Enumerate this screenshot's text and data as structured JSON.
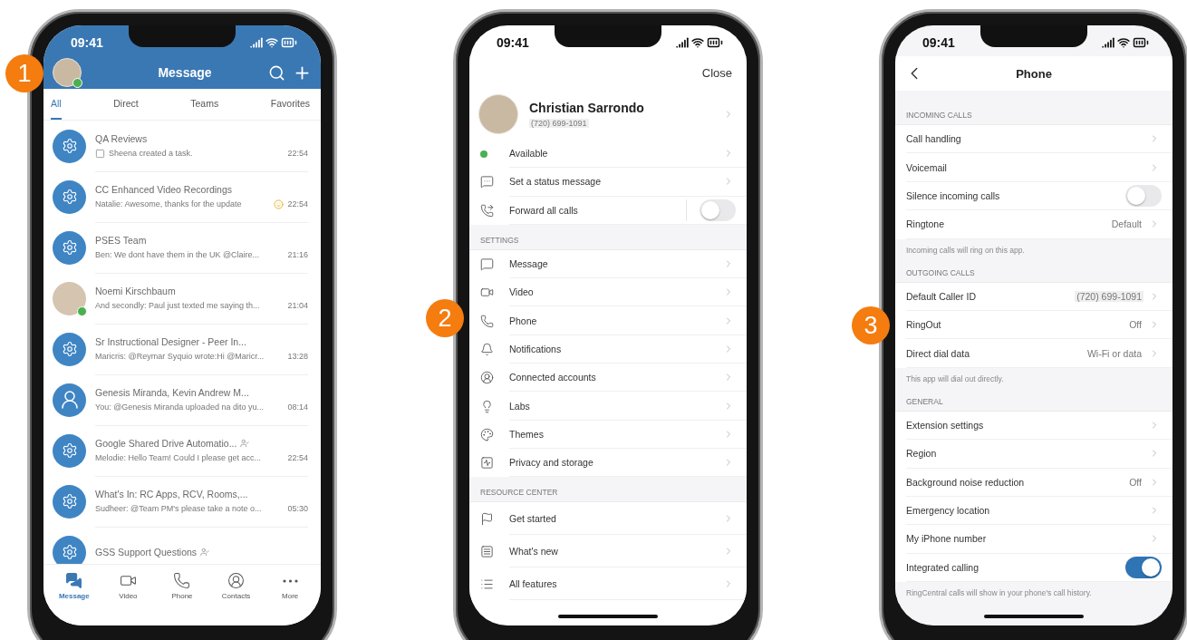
{
  "phones": [
    {
      "kind": "messages",
      "badge": "1",
      "time": "09:41",
      "header": {
        "title": "Message",
        "online": true
      },
      "tabs": [
        {
          "label": "All",
          "selected": true
        },
        {
          "label": "Direct",
          "selected": false
        },
        {
          "label": "Teams",
          "selected": false
        },
        {
          "label": "Favorites",
          "selected": false
        }
      ],
      "list": {
        "items": [
          {
            "kind": "team",
            "title": "QA Reviews",
            "preview": "Sheena created a task.",
            "time": "22:54",
            "task": true,
            "emoji": false,
            "guest": false,
            "online": false
          },
          {
            "kind": "team",
            "title": "CC Enhanced Video Recordings",
            "preview": "Natalie: Awesome, thanks for the update",
            "time": "22:54",
            "task": false,
            "emoji": true,
            "guest": false,
            "online": false
          },
          {
            "kind": "team",
            "title": "PSES Team",
            "preview": "Ben: We dont have them in the UK @Claire...",
            "time": "21:16",
            "task": false,
            "emoji": false,
            "guest": false,
            "online": false
          },
          {
            "kind": "person",
            "title": "Noemi Kirschbaum",
            "preview": "And secondly: Paul just texted me saying th...",
            "time": "21:04",
            "task": false,
            "emoji": false,
            "guest": false,
            "online": true
          },
          {
            "kind": "team",
            "title": "Sr Instructional Designer - Peer In...",
            "preview": "Maricris: @Reymar Syquio wrote:Hi @Maricr...",
            "time": "13:28",
            "task": false,
            "emoji": false,
            "guest": false,
            "online": false
          },
          {
            "kind": "group",
            "title": "Genesis Miranda, Kevin Andrew M...",
            "preview": "You: @Genesis Miranda uploaded na dito yu...",
            "time": "08:14",
            "task": false,
            "emoji": false,
            "guest": false,
            "online": false
          },
          {
            "kind": "team",
            "title": "Google Shared Drive Automatio...",
            "preview": "Melodie: Hello Team! Could I please get acc...",
            "time": "22:54",
            "task": false,
            "emoji": false,
            "guest": true,
            "online": false
          },
          {
            "kind": "team",
            "title": "What's In: RC Apps, RCV, Rooms,...",
            "preview": "Sudheer: @Team PM's please take a note o...",
            "time": "05:30",
            "task": false,
            "emoji": false,
            "guest": false,
            "online": false
          },
          {
            "kind": "team",
            "title": "GSS Support Questions",
            "task": false,
            "emoji": false,
            "guest": true,
            "online": false
          }
        ]
      },
      "nav": [
        {
          "label": "Message",
          "selected": true
        },
        {
          "label": "Video",
          "selected": false
        },
        {
          "label": "Phone",
          "selected": false
        },
        {
          "label": "Contacts",
          "selected": false
        },
        {
          "label": "More",
          "selected": false
        }
      ]
    },
    {
      "kind": "profile",
      "badge": "2",
      "time": "09:41",
      "close": "Close",
      "profile": {
        "name": "Christian Sarrondo",
        "phone": "(720) 699-1091",
        "blurred": true
      },
      "groups": [
        {
          "rows": [
            {
              "kind": "status",
              "label": "Available",
              "color": "#4caf50"
            },
            {
              "kind": "link",
              "label": "Set a status message"
            },
            {
              "kind": "toggle",
              "label": "Forward all calls",
              "on": false
            }
          ]
        },
        {
          "header": "SETTINGS",
          "rows": [
            {
              "kind": "link",
              "label": "Message"
            },
            {
              "kind": "link",
              "label": "Video"
            },
            {
              "kind": "link",
              "label": "Phone"
            },
            {
              "kind": "link",
              "label": "Notifications"
            },
            {
              "kind": "link",
              "label": "Connected accounts"
            },
            {
              "kind": "link",
              "label": "Labs"
            },
            {
              "kind": "link",
              "label": "Themes"
            },
            {
              "kind": "link",
              "label": "Privacy and storage"
            }
          ]
        },
        {
          "header": "RESOURCE CENTER",
          "rows": [
            {
              "kind": "link",
              "label": "Get started"
            },
            {
              "kind": "link",
              "label": "What's new"
            },
            {
              "kind": "link",
              "label": "All features"
            }
          ]
        }
      ]
    },
    {
      "kind": "settings",
      "badge": "3",
      "time": "09:41",
      "title": "Phone",
      "groups": [
        {
          "header": "INCOMING CALLS",
          "rows": [
            {
              "kind": "link",
              "label": "Call handling"
            },
            {
              "kind": "link",
              "label": "Voicemail"
            },
            {
              "kind": "toggle",
              "label": "Silence incoming calls",
              "on": false
            },
            {
              "kind": "link",
              "label": "Ringtone",
              "value": "Default"
            }
          ],
          "footer": "Incoming calls will ring on this app."
        },
        {
          "header": "OUTGOING CALLS",
          "rows": [
            {
              "kind": "link",
              "label": "Default Caller ID",
              "value": "(720) 699-1091",
              "blurred": true
            },
            {
              "kind": "link",
              "label": "RingOut",
              "value": "Off"
            },
            {
              "kind": "link",
              "label": "Direct dial data",
              "value": "Wi-Fi or data"
            }
          ],
          "footer": "This app will dial out directly."
        },
        {
          "header": "GENERAL",
          "rows": [
            {
              "kind": "link",
              "label": "Extension settings"
            },
            {
              "kind": "link",
              "label": "Region"
            },
            {
              "kind": "link",
              "label": "Background noise reduction",
              "value": "Off"
            },
            {
              "kind": "link",
              "label": "Emergency location"
            },
            {
              "kind": "link",
              "label": "My iPhone number"
            },
            {
              "kind": "toggle",
              "label": "Integrated calling",
              "on": true
            }
          ],
          "footer": "RingCentral calls will show in your phone's call history."
        }
      ]
    }
  ]
}
